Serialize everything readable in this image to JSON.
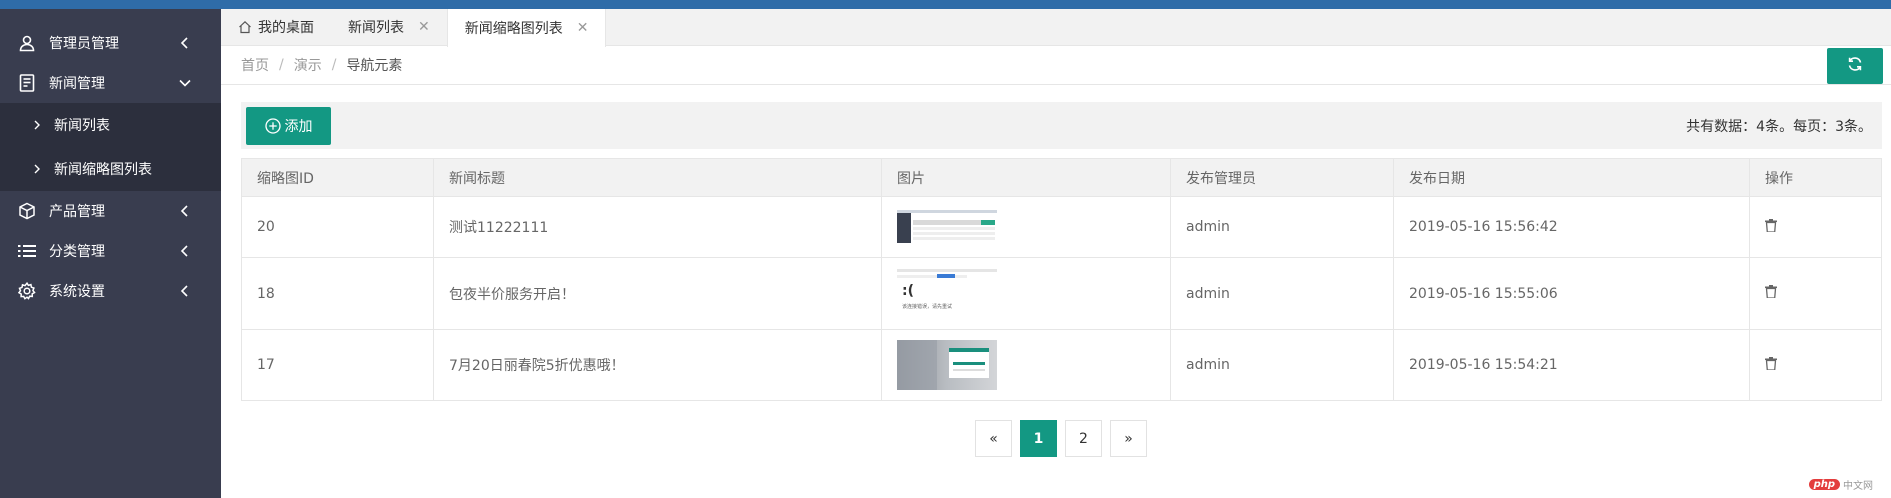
{
  "sidebar": {
    "items": [
      {
        "label": "管理员管理",
        "icon": "user-icon"
      },
      {
        "label": "新闻管理",
        "icon": "document-icon"
      },
      {
        "label": "产品管理",
        "icon": "cube-icon"
      },
      {
        "label": "分类管理",
        "icon": "list-icon"
      },
      {
        "label": "系统设置",
        "icon": "gear-icon"
      }
    ],
    "news_sub": [
      {
        "label": "新闻列表"
      },
      {
        "label": "新闻缩略图列表"
      }
    ]
  },
  "tabs": [
    {
      "label": "我的桌面"
    },
    {
      "label": "新闻列表"
    },
    {
      "label": "新闻缩略图列表"
    }
  ],
  "breadcrumb": [
    "首页",
    "演示",
    "导航元素"
  ],
  "toolbar": {
    "add_label": "添加",
    "counts": "共有数据：4条。每页：3条。"
  },
  "table": {
    "headers": [
      "缩略图ID",
      "新闻标题",
      "图片",
      "发布管理员",
      "发布日期",
      "操作"
    ],
    "rows": [
      {
        "id": "20",
        "title": "测试11222111",
        "admin": "admin",
        "date": "2019-05-16 15:56:42"
      },
      {
        "id": "18",
        "title": "包夜半价服务开启！",
        "admin": "admin",
        "date": "2019-05-16 15:55:06"
      },
      {
        "id": "17",
        "title": "7月20日丽春院5折优惠哦！",
        "admin": "admin",
        "date": "2019-05-16 15:54:21"
      }
    ]
  },
  "pagination": {
    "prev": "«",
    "pages": [
      "1",
      "2"
    ],
    "next": "»",
    "current": "1"
  },
  "thumbs": {
    "error_face": ":(",
    "error_text": "该连接错误，请先重试"
  },
  "watermark": {
    "php": "php",
    "site": "中文网"
  },
  "colors": {
    "accent": "#139883",
    "sidebar": "#393d4f",
    "topbar": "#2f6ca8"
  }
}
